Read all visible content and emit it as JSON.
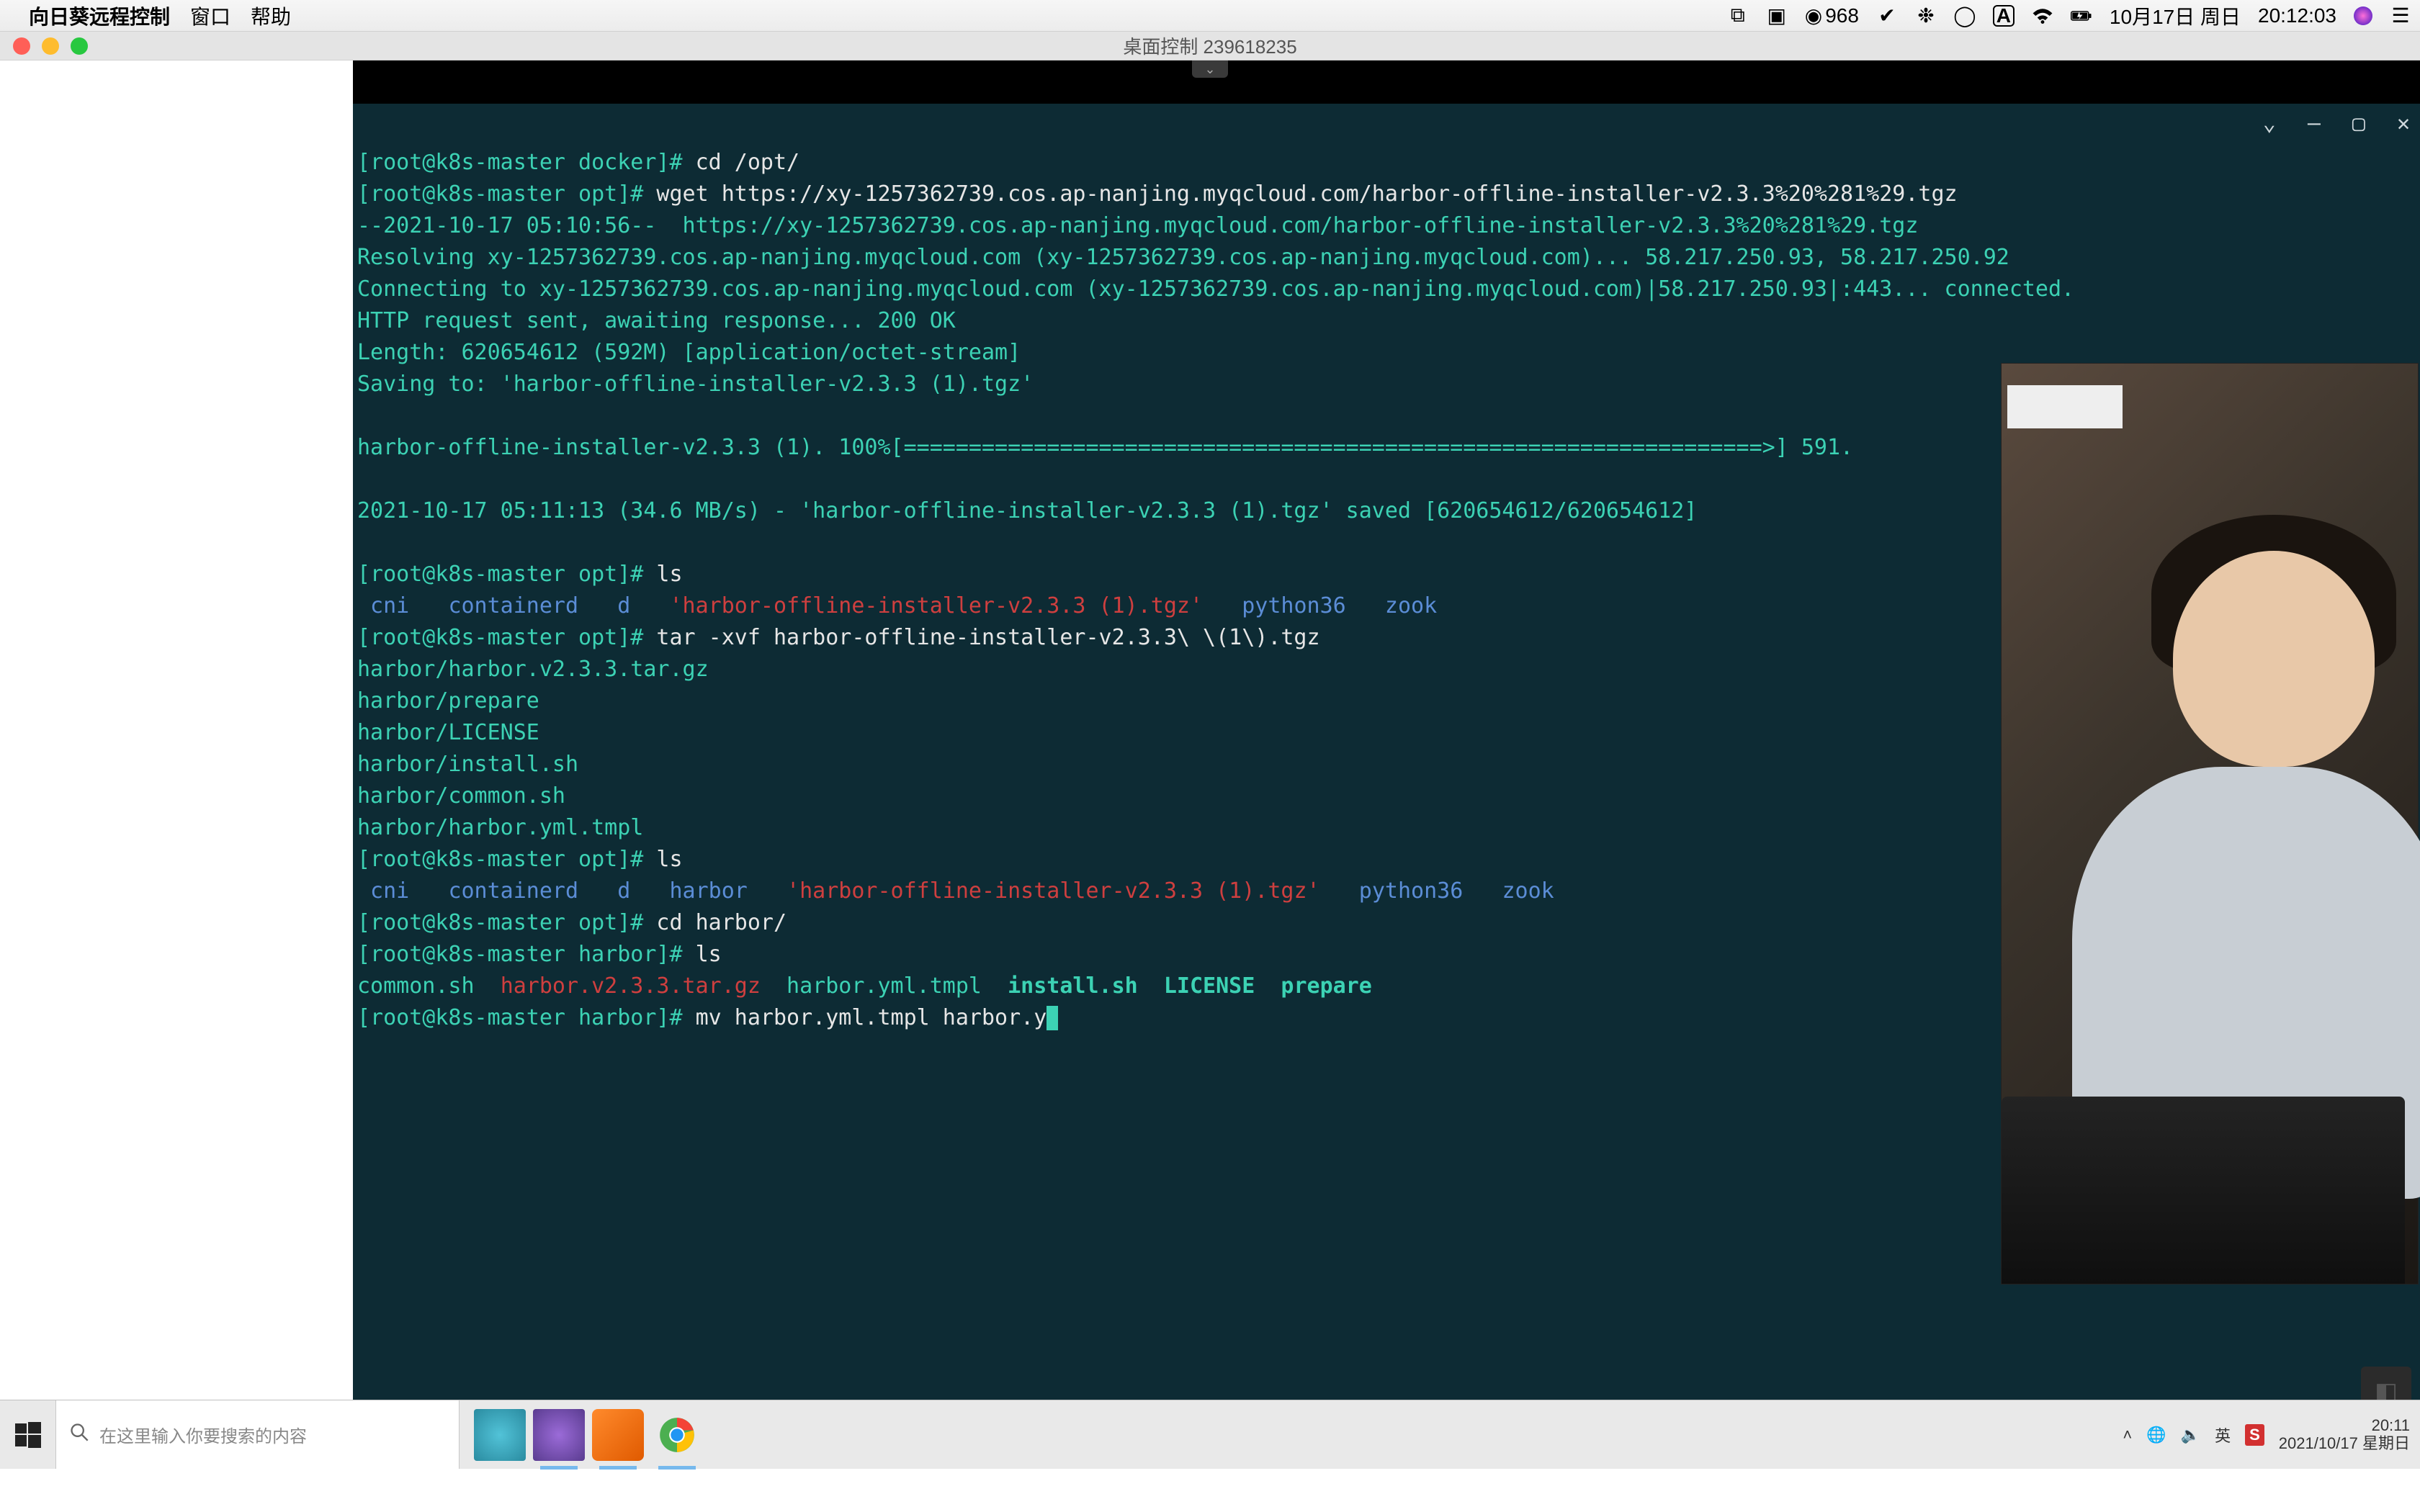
{
  "mac_menubar": {
    "app_name": "向日葵远程控制",
    "menu_window": "窗口",
    "menu_help": "帮助",
    "right": {
      "counter": "968",
      "date": "10月17日 周日",
      "time": "20:12:03",
      "input_label": "A"
    }
  },
  "remote_titlebar": {
    "title": "桌面控制 239618235"
  },
  "terminal": {
    "lines": {
      "l1_prompt": "[root@k8s-master docker]# ",
      "l1_cmd": "cd /opt/",
      "l2_prompt": "[root@k8s-master opt]# ",
      "l2_cmd": "wget https://xy-1257362739.cos.ap-nanjing.myqcloud.com/harbor-offline-installer-v2.3.3%20%281%29.tgz",
      "l3": "--2021-10-17 05:10:56--  https://xy-1257362739.cos.ap-nanjing.myqcloud.com/harbor-offline-installer-v2.3.3%20%281%29.tgz",
      "l4": "Resolving xy-1257362739.cos.ap-nanjing.myqcloud.com (xy-1257362739.cos.ap-nanjing.myqcloud.com)... 58.217.250.93, 58.217.250.92",
      "l5": "Connecting to xy-1257362739.cos.ap-nanjing.myqcloud.com (xy-1257362739.cos.ap-nanjing.myqcloud.com)|58.217.250.93|:443... connected.",
      "l6": "HTTP request sent, awaiting response... 200 OK",
      "l7": "Length: 620654612 (592M) [application/octet-stream]",
      "l8": "Saving to: 'harbor-offline-installer-v2.3.3 (1).tgz'",
      "l9": "harbor-offline-installer-v2.3.3 (1). 100%[==================================================================>] 591.",
      "l10": "2021-10-17 05:11:13 (34.6 MB/s) - 'harbor-offline-installer-v2.3.3 (1).tgz' saved [620654612/620654612]",
      "l11_prompt": "[root@k8s-master opt]# ",
      "l11_cmd": "ls",
      "ls1_cni": " cni",
      "ls1_containerd": "containerd",
      "ls1_d": "d",
      "ls1_tgz": "'harbor-offline-installer-v2.3.3 (1).tgz'",
      "ls1_python": "python36",
      "ls1_zook": "zook",
      "l12_prompt": "[root@k8s-master opt]# ",
      "l12_cmd": "tar -xvf harbor-offline-installer-v2.3.3\\ \\(1\\).tgz",
      "tar1": "harbor/harbor.v2.3.3.tar.gz",
      "tar2": "harbor/prepare",
      "tar3": "harbor/LICENSE",
      "tar4": "harbor/install.sh",
      "tar5": "harbor/common.sh",
      "tar6": "harbor/harbor.yml.tmpl",
      "l13_prompt": "[root@k8s-master opt]# ",
      "l13_cmd": "ls",
      "ls2_cni": " cni",
      "ls2_containerd": "containerd",
      "ls2_d": "d",
      "ls2_harbor": "harbor",
      "ls2_tgz": "'harbor-offline-installer-v2.3.3 (1).tgz'",
      "ls2_python": "python36",
      "ls2_zook": "zook",
      "l14_prompt": "[root@k8s-master opt]# ",
      "l14_cmd": "cd harbor/",
      "l15_prompt": "[root@k8s-master harbor]# ",
      "l15_cmd": "ls",
      "ls3_common": "common.sh",
      "ls3_tar": "harbor.v2.3.3.tar.gz",
      "ls3_tmpl": "harbor.yml.tmpl",
      "ls3_install": "install.sh",
      "ls3_license": "LICENSE",
      "ls3_prepare": "prepare",
      "l16_prompt": "[root@k8s-master harbor]# ",
      "l16_cmd": "mv harbor.yml.tmpl harbor.y"
    }
  },
  "windows_taskbar": {
    "search_placeholder": "在这里输入你要搜索的内容",
    "tray_input": "英",
    "tray_region": "S",
    "time": "20:11",
    "date": "2021/10/17 星期日"
  }
}
